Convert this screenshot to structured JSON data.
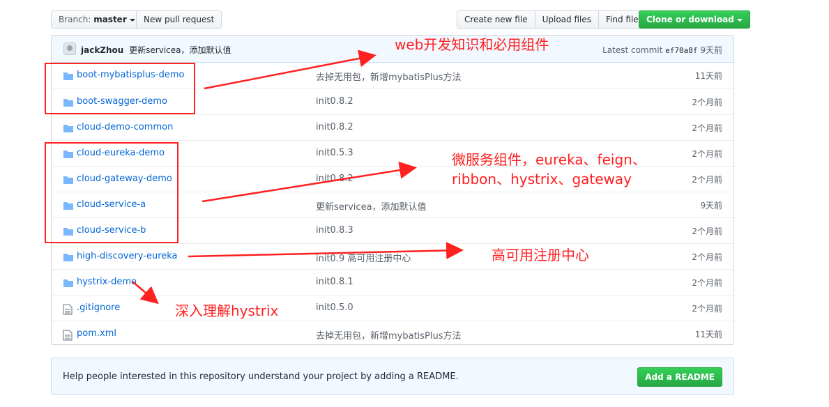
{
  "toolbar": {
    "branch_prefix": "Branch:",
    "branch_name": "master",
    "new_pull_request": "New pull request",
    "create_new_file": "Create new file",
    "upload_files": "Upload files",
    "find_file": "Find file",
    "clone_or_download": "Clone or download"
  },
  "commit": {
    "author": "jackZhou",
    "message": "更新servicea，添加默认值",
    "latest_label": "Latest commit",
    "sha": "ef70a8f",
    "age": "9天前"
  },
  "files": [
    {
      "type": "dir",
      "name": "boot-mybatisplus-demo",
      "message": "去掉无用包，新增mybatisPlus方法",
      "age": "11天前"
    },
    {
      "type": "dir",
      "name": "boot-swagger-demo",
      "message": "init0.8.2",
      "age": "2个月前"
    },
    {
      "type": "dir",
      "name": "cloud-demo-common",
      "message": "init0.8.2",
      "age": "2个月前"
    },
    {
      "type": "dir",
      "name": "cloud-eureka-demo",
      "message": "init0.5.3",
      "age": "2个月前"
    },
    {
      "type": "dir",
      "name": "cloud-gateway-demo",
      "message": "init0.8.2",
      "age": "2个月前"
    },
    {
      "type": "dir",
      "name": "cloud-service-a",
      "message": "更新servicea，添加默认值",
      "age": "9天前"
    },
    {
      "type": "dir",
      "name": "cloud-service-b",
      "message": "init0.8.3",
      "age": "2个月前"
    },
    {
      "type": "dir",
      "name": "high-discovery-eureka",
      "message": "init0.9 高可用注册中心",
      "age": "2个月前"
    },
    {
      "type": "dir",
      "name": "hystrix-demo",
      "message": "init0.8.1",
      "age": "2个月前"
    },
    {
      "type": "file",
      "name": ".gitignore",
      "message": "init0.5.0",
      "age": "2个月前"
    },
    {
      "type": "file",
      "name": "pom.xml",
      "message": "去掉无用包，新增mybatisPlus方法",
      "age": "11天前"
    }
  ],
  "readme": {
    "text": "Help people interested in this repository understand your project by adding a README.",
    "button": "Add a README"
  },
  "annotations": {
    "web": "web开发知识和必用组件",
    "micro_line1": "微服务组件，eureka、feign、",
    "micro_line2": "ribbon、hystrix、gateway",
    "ha": "高可用注册中心",
    "hystrix": "深入理解hystrix"
  },
  "colors": {
    "link": "#0366d6",
    "green_button": "#28a745",
    "annotation_red": "#ff2020",
    "commit_bar": "#f1f8ff"
  }
}
